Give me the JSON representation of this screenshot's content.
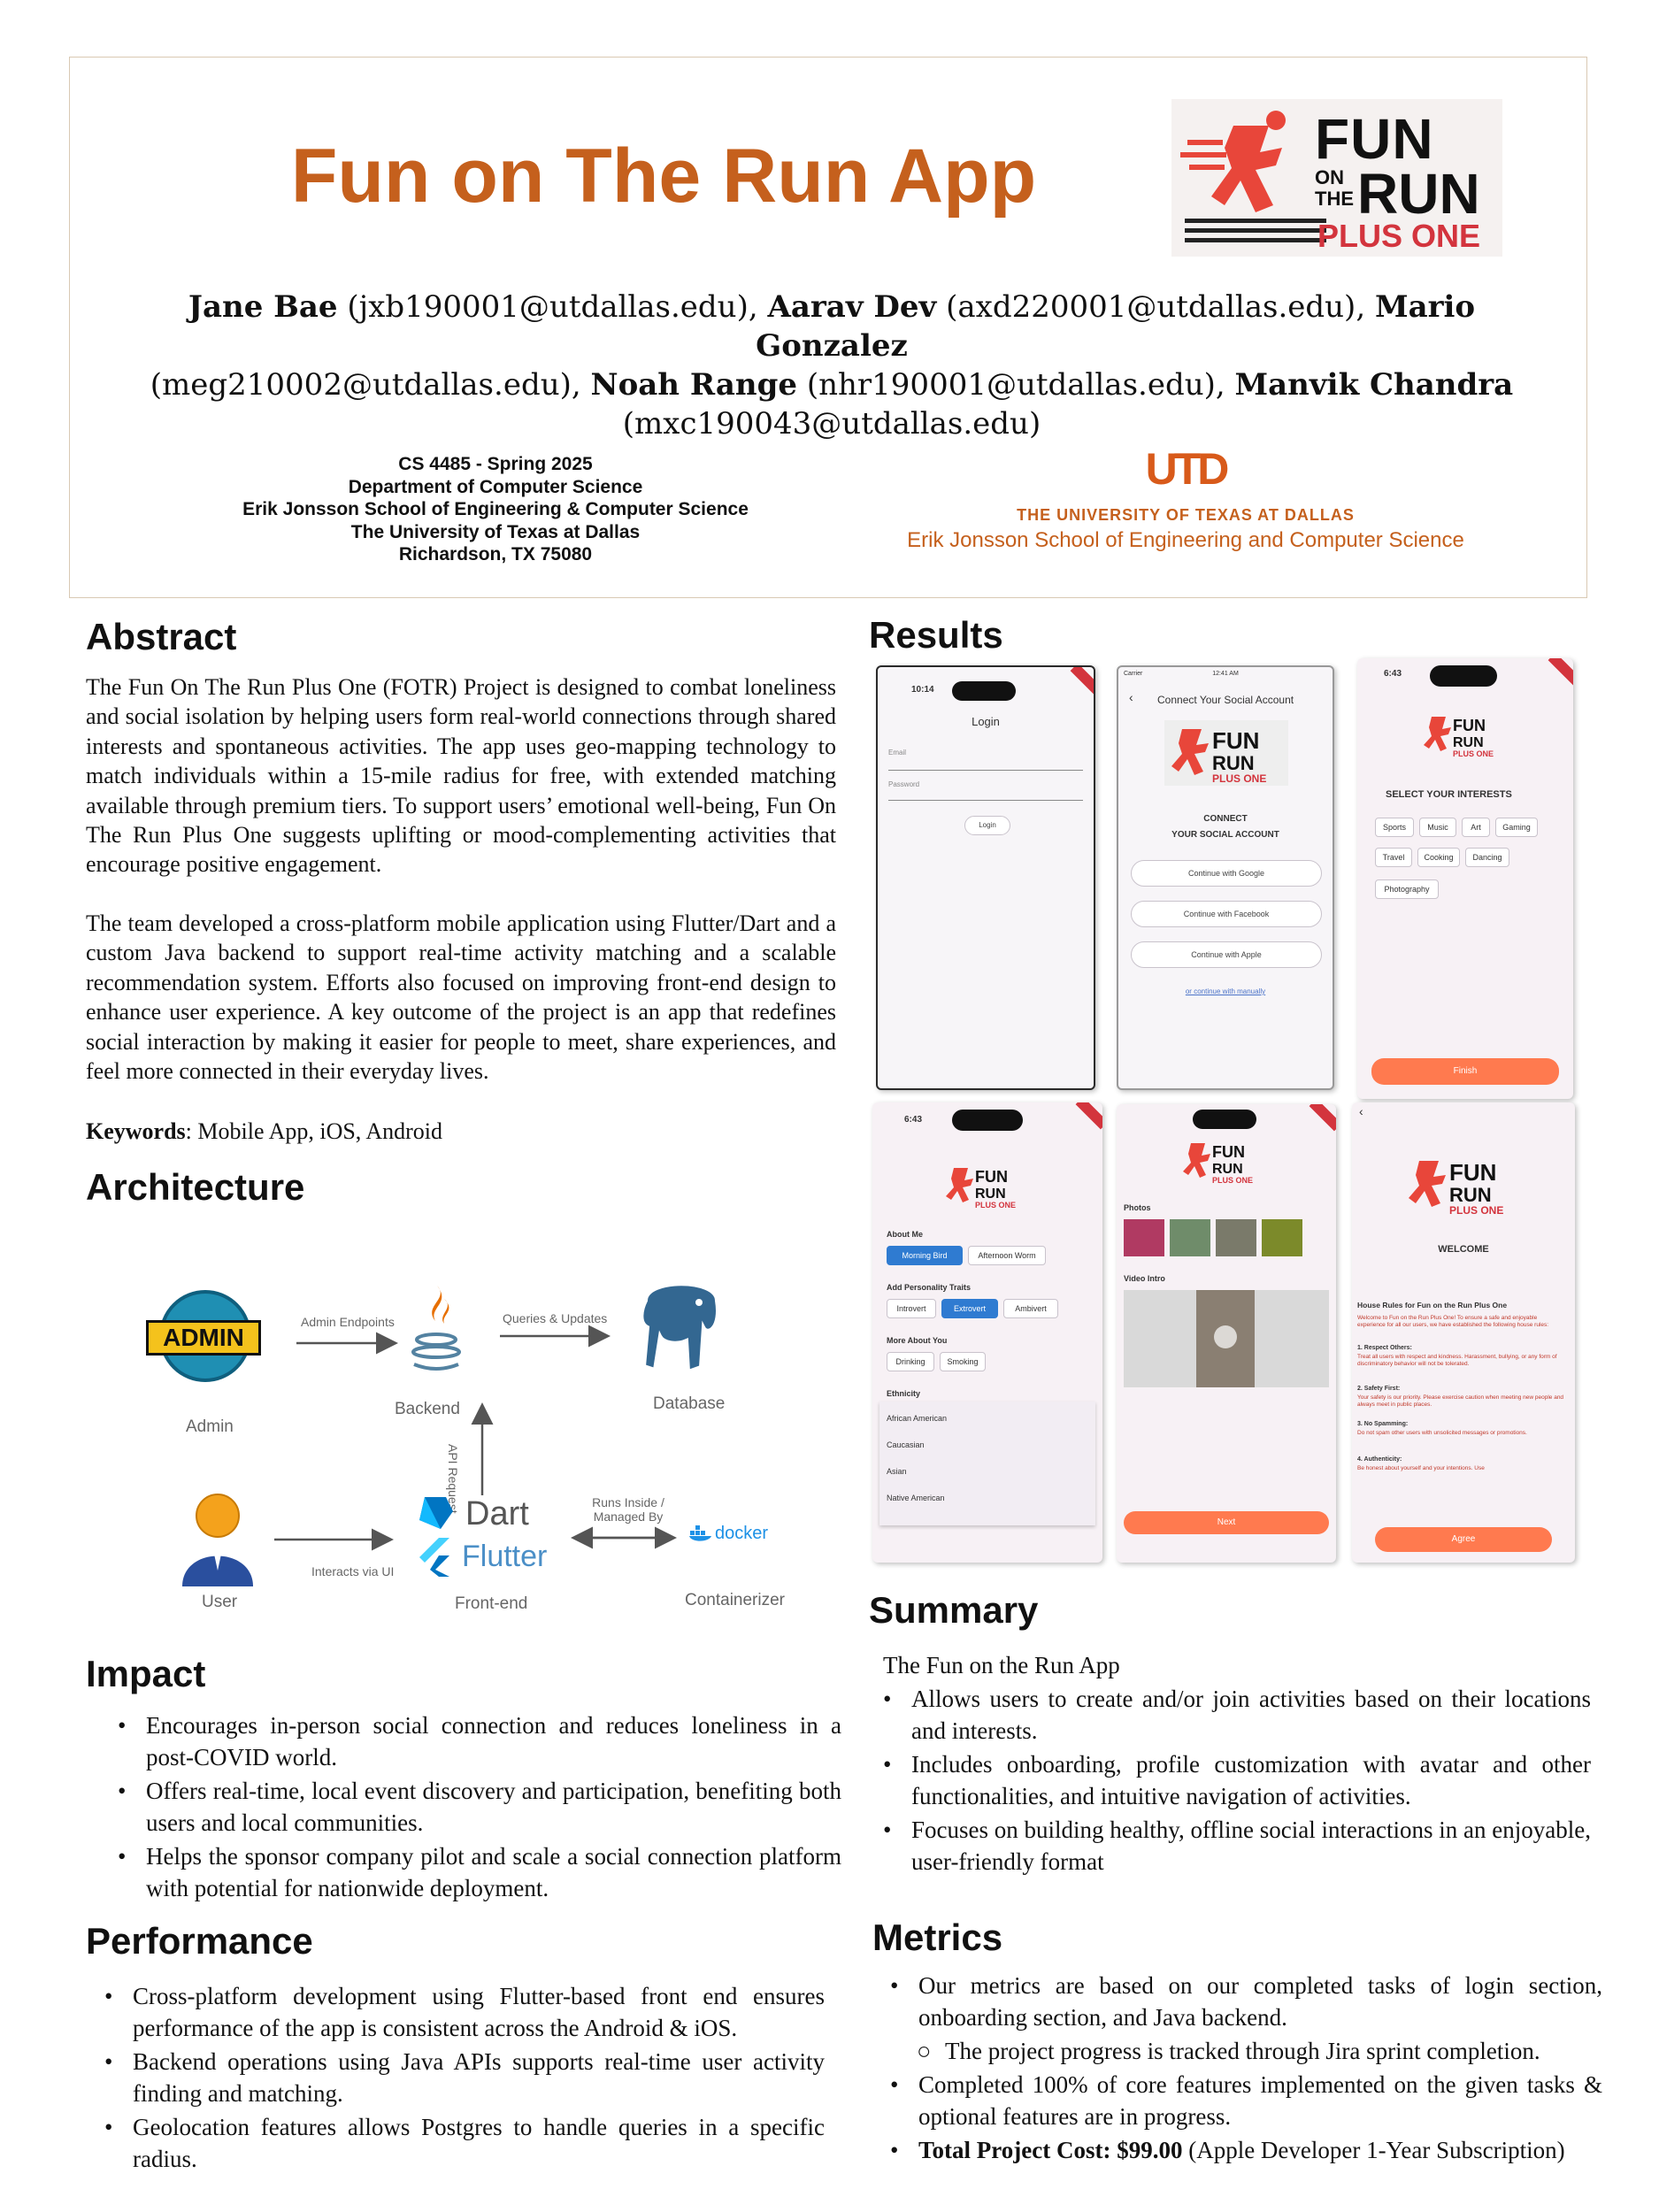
{
  "header": {
    "title": "Fun on The Run App",
    "authors": [
      {
        "name": "Jane Bae",
        "email": "(jxb190001@utdallas.edu)"
      },
      {
        "name": "Aarav Dev",
        "email": "(axd220001@utdallas.edu)"
      },
      {
        "name": "Mario Gonzalez",
        "email": "(meg210002@utdallas.edu)"
      },
      {
        "name": "Noah Range",
        "email": "(nhr190001@utdallas.edu)"
      },
      {
        "name": "Manvik Chandra",
        "email": "(mxc190043@utdallas.edu)"
      }
    ],
    "affiliation": [
      "CS 4485 - Spring 2025",
      "Department of Computer Science",
      "Erik Jonsson School of Engineering & Computer Science",
      "The University of Texas at Dallas",
      "Richardson, TX 75080"
    ],
    "logo": {
      "line1": "FUN",
      "line2a": "ON",
      "line2b": "THE",
      "line2c": "RUN",
      "line3": "PLUS ONE"
    },
    "utd": {
      "mark": "UTD",
      "line1": "THE UNIVERSITY OF TEXAS AT DALLAS",
      "line2": "Erik Jonsson School of Engineering and Computer Science"
    },
    "colors": {
      "accent": "#c5601d",
      "red": "#d3343d",
      "orange_button": "#ff7a4f"
    }
  },
  "abstract": {
    "heading": "Abstract",
    "p1": "The Fun On The Run Plus One (FOTR) Project is designed to combat loneliness and social isolation by helping users form real-world connections through shared interests and spontaneous activities. The app uses geo-mapping technology to match individuals within a 15-mile radius for free, with extended matching available through premium tiers. To support users’ emotional well-being, Fun On The Run Plus One suggests uplifting or mood-complementing activities that encourage positive engagement.",
    "p2": "The team developed a cross-platform mobile application using Flutter/Dart and a custom Java backend to support real-time activity matching and a scalable recommendation system. Efforts also focused on improving front-end design to enhance user experience. A key outcome of the project is an app that redefines social interaction by making it easier for people to meet, share experiences, and feel more connected in their everyday lives.",
    "keywords_label": "Keywords",
    "keywords": ": Mobile App, iOS, Android"
  },
  "architecture": {
    "heading": "Architecture",
    "nodes": {
      "admin": "Admin",
      "admin_badge": "ADMIN",
      "backend": "Backend",
      "database": "Database",
      "user": "User",
      "frontend": "Front-end",
      "containerizer": "Containerizer",
      "dart": "Dart",
      "flutter": "Flutter",
      "docker": "docker"
    },
    "edges": {
      "admin_endpoints": "Admin Endpoints",
      "queries": "Queries & Updates",
      "api_request": "API Request",
      "interacts": "Interacts via UI",
      "runs_inside_1": "Runs Inside /",
      "runs_inside_2": "Managed By"
    }
  },
  "impact": {
    "heading": "Impact",
    "items": [
      "Encourages in-person social connection and reduces loneliness in a post-COVID world.",
      "Offers real-time, local event discovery and participation, benefiting both users and local communities.",
      "Helps the sponsor company pilot and scale a social connection platform with potential for nationwide deployment."
    ]
  },
  "performance": {
    "heading": "Performance",
    "items": [
      "Cross-platform development using Flutter-based front end ensures performance of the app is consistent across the Android & iOS.",
      "Backend operations using Java APIs supports real-time user activity finding and matching.",
      "Geolocation features allows Postgres to handle queries in a specific radius."
    ]
  },
  "results": {
    "heading": "Results",
    "s1": {
      "time": "10:14",
      "title": "Login",
      "email": "Email",
      "password": "Password",
      "button": "Login"
    },
    "s2": {
      "carrier": "Carrier",
      "time": "12:41 AM",
      "title": "Connect Your Social Account",
      "connect1": "CONNECT",
      "connect2": "YOUR SOCIAL ACCOUNT",
      "google": "Continue with Google",
      "facebook": "Continue with Facebook",
      "apple": "Continue with Apple",
      "manual": "or continue with manually"
    },
    "s3": {
      "time": "6:43",
      "heading": "SELECT YOUR INTERESTS",
      "chips": [
        "Sports",
        "Music",
        "Art",
        "Gaming",
        "Travel",
        "Cooking",
        "Dancing",
        "Photography"
      ],
      "button": "Finish"
    },
    "s4": {
      "time": "6:43",
      "about": "About Me",
      "about_chips": [
        "Morning Bird",
        "Afternoon Worm"
      ],
      "traits": "Add Personality Traits",
      "trait_chips": [
        "Introvert",
        "Extrovert",
        "Ambivert"
      ],
      "more": "More About You",
      "more_chips": [
        "Drinking",
        "Smoking"
      ],
      "ethnicity": "Ethnicity",
      "options": [
        "African American",
        "Caucasian",
        "Asian",
        "Native American"
      ]
    },
    "s5": {
      "photos": "Photos",
      "video": "Video Intro",
      "button": "Next"
    },
    "s6": {
      "welcome": "WELCOME",
      "rules_title": "House Rules for Fun on the Run Plus One",
      "rules_intro": "Welcome to Fun on the Run Plus One! To ensure a safe and enjoyable experience for all our users, we have established the following house rules:",
      "r1_t": "1. Respect Others:",
      "r1": "Treat all users with respect and kindness. Harassment, bullying, or any form of discriminatory behavior will not be tolerated.",
      "r2_t": "2. Safety First:",
      "r2": "Your safety is our priority. Please exercise caution when meeting new people and always meet in public places.",
      "r3_t": "3. No Spamming:",
      "r3": "Do not spam other users with unsolicited messages or promotions.",
      "r4_t": "4. Authenticity:",
      "r4": "Be honest about yourself and your intentions. Use",
      "button": "Agree"
    }
  },
  "summary": {
    "heading": "Summary",
    "lead": "The Fun on the Run App",
    "items": [
      "Allows users to create and/or join activities based on their locations and interests.",
      "Includes onboarding, profile customization with avatar and other functionalities, and intuitive navigation of activities.",
      "Focuses on building healthy, offline social interactions in an enjoyable, user-friendly format"
    ]
  },
  "metrics": {
    "heading": "Metrics",
    "item1": "Our metrics are based on our completed tasks of login section, onboarding section, and Java backend.",
    "sub1": "The project progress is tracked through Jira sprint completion.",
    "item2": "Completed 100% of core features implemented on the given tasks & optional features are in progress.",
    "item3_label": "Total Project Cost: $99.00",
    "item3": " (Apple Developer 1-Year Subscription)"
  }
}
